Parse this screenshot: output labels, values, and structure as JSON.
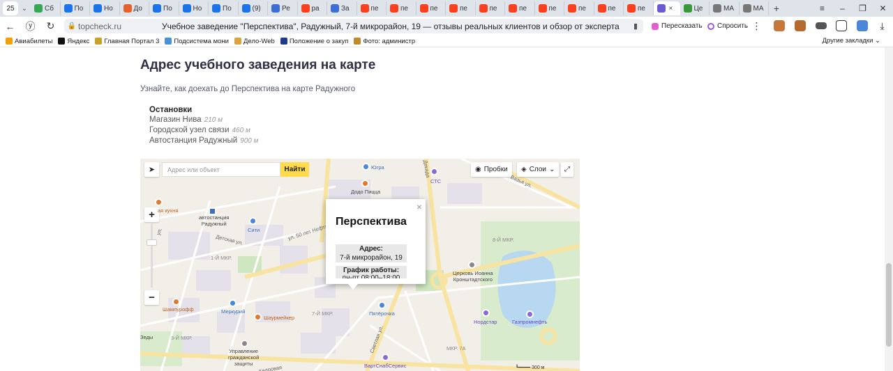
{
  "browser": {
    "tab_counter": "25",
    "tabs": [
      {
        "label": "Сб",
        "icon": "g-icon",
        "color": "#34a853"
      },
      {
        "label": "По",
        "icon": "mail-icon",
        "color": "#1a73e8"
      },
      {
        "label": "Но",
        "icon": "at-icon",
        "color": "#1a73e8"
      },
      {
        "label": "До",
        "icon": "gradient-icon",
        "color": "#e8602c"
      },
      {
        "label": "По",
        "icon": "mail-icon",
        "color": "#1a73e8"
      },
      {
        "label": "Но",
        "icon": "at-icon",
        "color": "#1a73e8"
      },
      {
        "label": "По",
        "icon": "mail-icon",
        "color": "#1a73e8"
      },
      {
        "label": "(9)",
        "icon": "mail-icon",
        "color": "#1a73e8"
      },
      {
        "label": "Ре",
        "icon": "flag-icon",
        "color": "#3b6fd4"
      },
      {
        "label": "ра",
        "icon": "yandex-icon",
        "color": "#fc3f1d"
      },
      {
        "label": "За",
        "icon": "link-icon",
        "color": "#3b6fd4"
      },
      {
        "label": "пе",
        "icon": "yandex-icon",
        "color": "#fc3f1d"
      },
      {
        "label": "пе",
        "icon": "yandex-icon",
        "color": "#fc3f1d"
      },
      {
        "label": "пе",
        "icon": "yandex-icon",
        "color": "#fc3f1d"
      },
      {
        "label": "пе",
        "icon": "yandex-icon",
        "color": "#fc3f1d"
      },
      {
        "label": "пе",
        "icon": "yandex-icon",
        "color": "#fc3f1d"
      },
      {
        "label": "пе",
        "icon": "yandex-icon",
        "color": "#fc3f1d"
      },
      {
        "label": "пе",
        "icon": "yandex-icon",
        "color": "#fc3f1d"
      },
      {
        "label": "пе",
        "icon": "yandex-icon",
        "color": "#fc3f1d"
      },
      {
        "label": "пе",
        "icon": "yandex-icon",
        "color": "#fc3f1d"
      },
      {
        "label": "пе",
        "icon": "yandex-icon",
        "color": "#fc3f1d"
      }
    ],
    "active_tab_close": "×",
    "tabs_after": [
      {
        "label": "Це",
        "icon": "leaf-icon",
        "color": "#3a9a3a"
      },
      {
        "label": "МА",
        "icon": "doc-icon",
        "color": "#777777"
      },
      {
        "label": "МА",
        "icon": "doc-icon",
        "color": "#777777"
      }
    ],
    "new_tab": "+",
    "url_host": "topcheck.ru",
    "page_title": "Учебное заведение \"Перспектива\", Радужный, 7-й микрорайон, 19 — отзывы реальных клиентов и обзор от эксперта",
    "retell_label": "Пересказать",
    "ask_label": "Спросить",
    "bookmarks": [
      {
        "label": "Авиабилеты",
        "icon": "plane-icon",
        "color": "#f59e0b"
      },
      {
        "label": "Яндекс",
        "icon": "plus-icon",
        "color": "#111111"
      },
      {
        "label": "Главная Портал 3",
        "icon": "lion-icon",
        "color": "#c9a227"
      },
      {
        "label": "Подсистема мони",
        "icon": "monitor-icon",
        "color": "#4a90d9"
      },
      {
        "label": "Дело-Web",
        "icon": "delo-icon",
        "color": "#d9a441"
      },
      {
        "label": "Положение о закуп",
        "icon": "book-icon",
        "color": "#1e3a8a"
      },
      {
        "label": "Фото: администр",
        "icon": "photo-icon",
        "color": "#c08a2b"
      }
    ],
    "other_bookmarks": "Другие закладки"
  },
  "page": {
    "section_title": "Адрес учебного заведения на карте",
    "subtitle": "Узнайте, как доехать до Перспектива на карте Радужного",
    "stops_title": "Остановки",
    "stops": [
      {
        "name": "Магазин Нива",
        "distance": "210 м"
      },
      {
        "name": "Городской узел связи",
        "distance": "460 м"
      },
      {
        "name": "Автостанция Радужный",
        "distance": "900 м"
      }
    ]
  },
  "map": {
    "search_placeholder": "Адрес или объект",
    "search_button": "Найти",
    "traffic_label": "Пробки",
    "layers_label": "Слои",
    "zoom_in": "+",
    "zoom_out": "−",
    "balloon": {
      "title": "Перспектива",
      "address_label": "Адрес:",
      "address_value": "7-й микрорайон, 19",
      "hours_label": "График работы:",
      "hours_value": "пн-пт 08:00–18:00"
    },
    "pois": {
      "yugra": "Югра",
      "dodo": "Додо Пицца",
      "sts": "СТС",
      "kitchen": "ая кухня",
      "bus_station": "автостанция\nРадужный",
      "siti": "Сити",
      "church": "Церковь Иоанна\nКронштадтского",
      "shampur": "Шампурофф",
      "merkuriy": "Меркурий",
      "shaurmeyker": "Шаурмейкер",
      "pyaterochka": "Пятёрочка",
      "nordstar": "Нордстар",
      "gazprom": "Газпромнефть",
      "civil_defense": "Управление\nгражданской\nзащиты",
      "vartsnab": "ВартСнабСервис",
      "beds": "Зеды"
    },
    "labels": {
      "mkr1": "1-Й МКР.",
      "mkr3": "3-Й МКР.",
      "mkr7": "7-Й МКР.",
      "mkr8": "8-Й МКР.",
      "mkr7a": "МКР. 7А",
      "street_neftyanikov": "ул. 50 лет Нефтяников",
      "street_detskaya": "Детская ул.",
      "street_svetlaya": "Светлая ул.",
      "street_vazhskaya": "Вазья ул.",
      "street_dekadnaya": "Декада",
      "street_ulya": "ул.",
      "street_kedrovaya": "Кедровая"
    },
    "scale_label": "300 м"
  },
  "colors": {
    "accent_yellow": "#ffdb4d",
    "map_bg": "#f2efe8",
    "road": "#ffffff",
    "road_major": "#f8e3a1",
    "green": "#cfe7c0",
    "water": "#b8d8f2"
  }
}
